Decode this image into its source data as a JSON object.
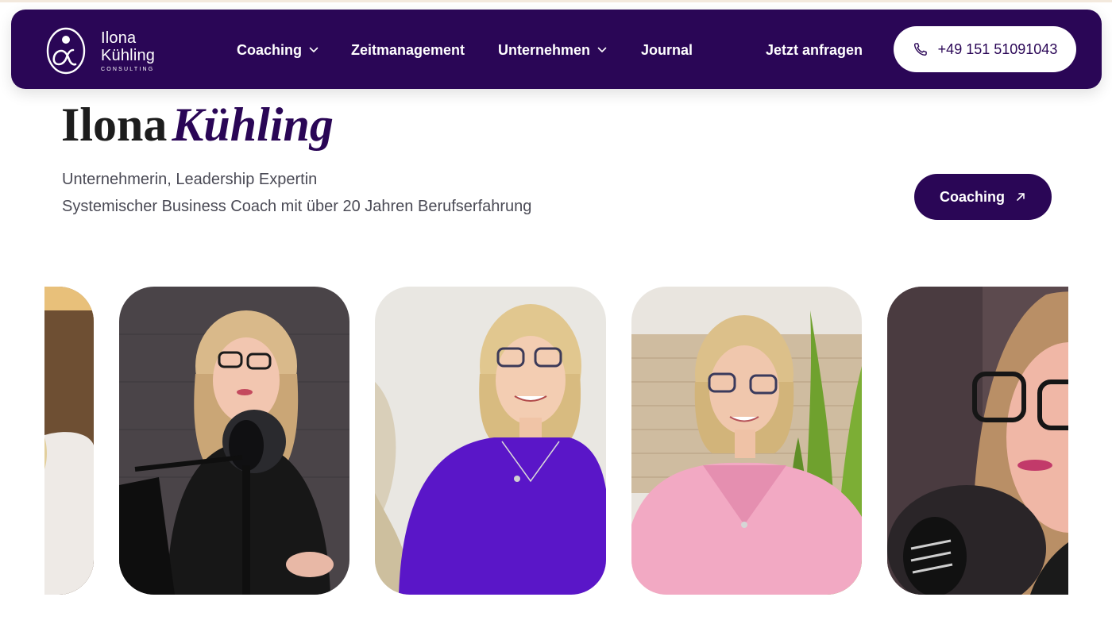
{
  "brand": {
    "name_line1": "Ilona",
    "name_line2": "Kühling",
    "subtitle": "CONSULTING",
    "logo_icon": "alpha-person-logo"
  },
  "nav": {
    "items": [
      {
        "label": "Coaching",
        "has_dropdown": true
      },
      {
        "label": "Zeitmanagement",
        "has_dropdown": false
      },
      {
        "label": "Unternehmen",
        "has_dropdown": true
      },
      {
        "label": "Journal",
        "has_dropdown": false
      }
    ],
    "request_label": "Jetzt anfragen",
    "phone": "+49 151 51091043",
    "phone_icon": "phone-icon"
  },
  "hero": {
    "title_plain": "Ilona",
    "title_italic": "Kühling",
    "subline1": "Unternehmerin, Leadership Expertin",
    "subline2": "Systemischer Business Coach mit über 20 Jahren Berufserfahrung",
    "cta_label": "Coaching",
    "cta_icon": "arrow-up-right-icon"
  },
  "gallery": {
    "photos": [
      {
        "name": "portrait-white-blouse-partial"
      },
      {
        "name": "portrait-podcast-microphone"
      },
      {
        "name": "portrait-purple-sweater"
      },
      {
        "name": "portrait-pink-sweater-plant"
      },
      {
        "name": "portrait-closeup-microphone-partial"
      }
    ]
  },
  "colors": {
    "brand_purple": "#2a0656",
    "text_gray": "#4a4a55",
    "background": "#ffffff"
  }
}
